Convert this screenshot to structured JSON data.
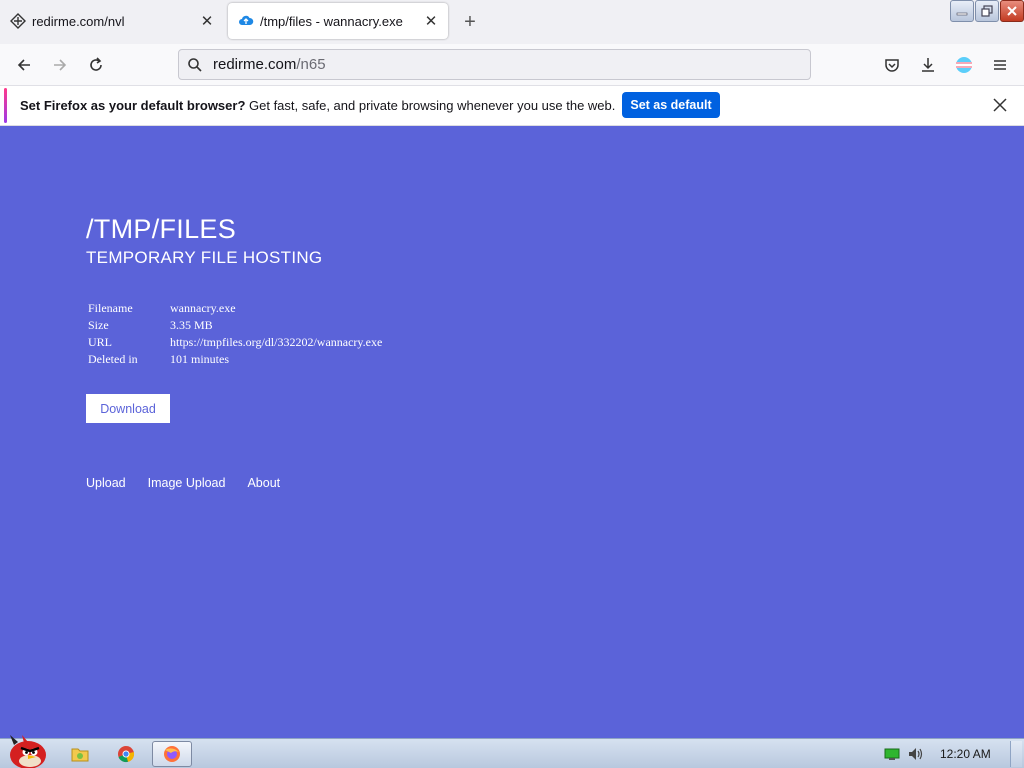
{
  "tabs": [
    {
      "label": "redirme.com/nvl",
      "active": false
    },
    {
      "label": "/tmp/files - wannacry.exe",
      "active": true
    }
  ],
  "url": {
    "host": "redirme.com",
    "path": "/n65"
  },
  "notification": {
    "bold": "Set Firefox as your default browser?",
    "text": " Get fast, safe, and private browsing whenever you use the web.",
    "button": "Set as default"
  },
  "page": {
    "title": "/TMP/FILES",
    "subtitle": "TEMPORARY FILE HOSTING",
    "file_info": [
      {
        "key": "Filename",
        "value": "wannacry.exe"
      },
      {
        "key": "Size",
        "value": "3.35 MB"
      },
      {
        "key": "URL",
        "value": "https://tmpfiles.org/dl/332202/wannacry.exe"
      },
      {
        "key": "Deleted in",
        "value": "101 minutes"
      }
    ],
    "download_label": "Download",
    "nav": [
      "Upload",
      "Image Upload",
      "About"
    ]
  },
  "taskbar": {
    "clock": "12:20 AM"
  },
  "colors": {
    "page_bg": "#5b63d9",
    "button_blue": "#0061e0"
  }
}
